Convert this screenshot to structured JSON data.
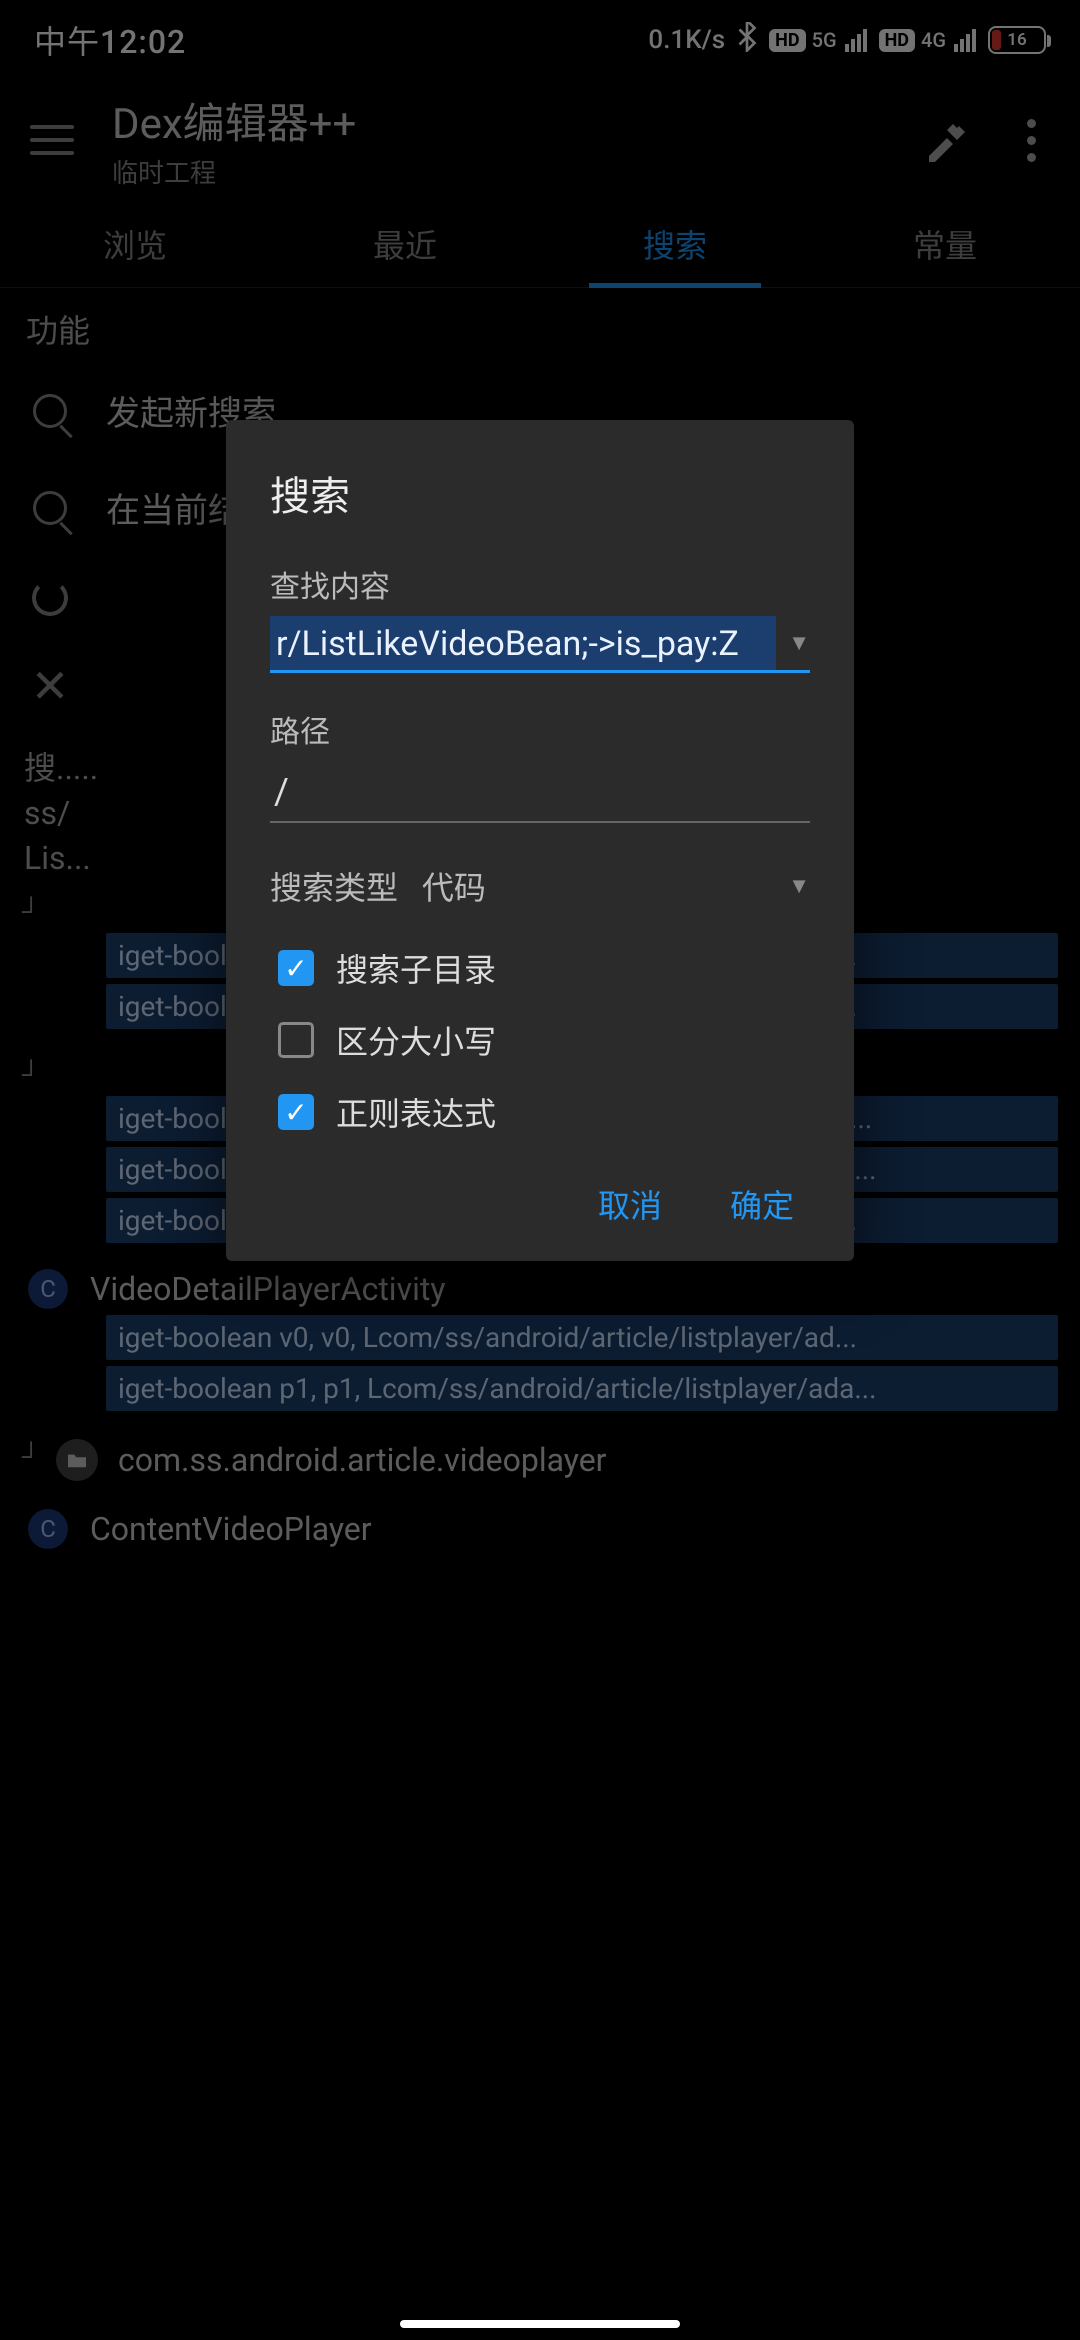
{
  "status": {
    "time": "中午12:02",
    "speed": "0.1K/s",
    "net1": "5G",
    "net2": "4G",
    "battery": "16"
  },
  "appbar": {
    "title": "Dex编辑器++",
    "subtitle": "临时工程"
  },
  "tabs": [
    "浏览",
    "最近",
    "搜索",
    "常量"
  ],
  "section": "功能",
  "actions": {
    "newSearch": "发起新搜索",
    "inResults": "在当前结果中搜索"
  },
  "searchMeta": {
    "l1": "搜.....",
    "l2": "ss/",
    "l3": "Lis..."
  },
  "results": {
    "grp1": {
      "lines": [
        "iget-boolean v0, v0, Lcom/ss/android/article/listplayer/ad...",
        "iget-boolean v0, v0, Lcom/ss/android/article/listplayer/ad..."
      ]
    },
    "grp2": {
      "lines": [
        "iget-boolean v0, v0, Lcom/ss/android/article/listplayer/ada...",
        "iget-boolean p1, p1, Lcom/ss/android/article/listplayer/ada...",
        "iget-boolean v0, v0, Lcom/ss/android/article/listplayer/ad..."
      ]
    },
    "grp3": {
      "title": "VideoDetailPlayerActivity",
      "lines": [
        "iget-boolean v0, v0, Lcom/ss/android/article/listplayer/ad...",
        "iget-boolean p1, p1, Lcom/ss/android/article/listplayer/ada..."
      ]
    },
    "grp4": {
      "title": "com.ss.android.article.videoplayer"
    },
    "grp5": {
      "title": "ContentVideoPlayer"
    }
  },
  "dialog": {
    "title": "搜索",
    "findLabel": "查找内容",
    "findValue": "r/ListLikeVideoBean;->is_pay:Z",
    "pathLabel": "路径",
    "pathValue": "/",
    "typeLabel": "搜索类型",
    "typeValue": "代码",
    "chkSub": "搜索子目录",
    "chkCase": "区分大小写",
    "chkRegex": "正则表达式",
    "cancel": "取消",
    "ok": "确定"
  }
}
